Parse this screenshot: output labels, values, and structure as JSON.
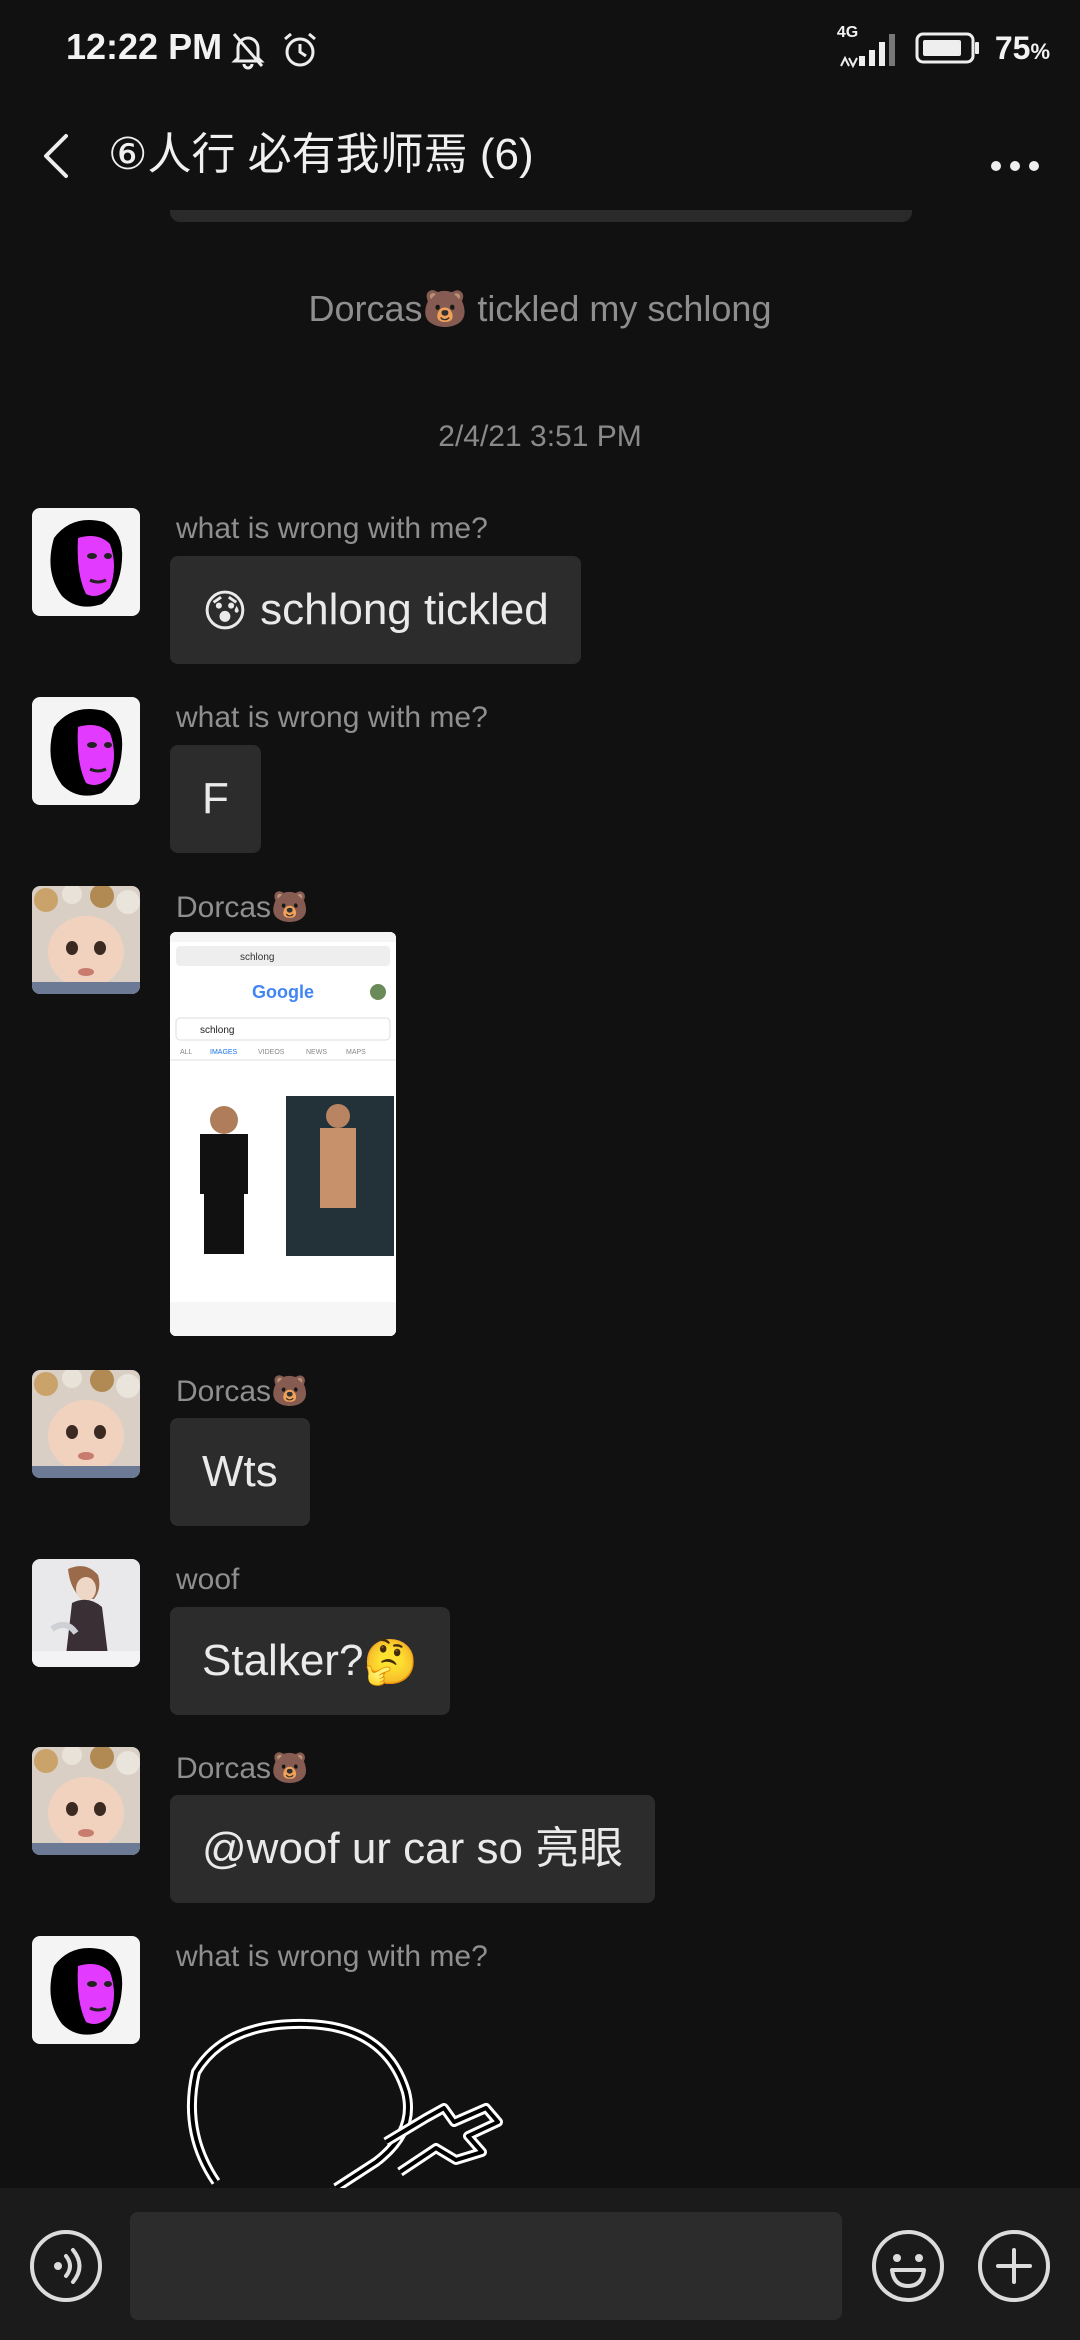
{
  "status": {
    "time": "12:22 PM",
    "network": "4G",
    "battery": "75",
    "battery_unit": "%"
  },
  "header": {
    "title": "⑥人行 必有我师焉 (6)"
  },
  "system_message": "Dorcas🐻 tickled my schlong",
  "timestamp": "2/4/21 3:51 PM",
  "messages": [
    {
      "sender": "what is wrong with me?",
      "text": "schlong tickled",
      "emoji": "😰"
    },
    {
      "sender": "what is wrong with me?",
      "text": "F"
    },
    {
      "sender": "Dorcas🐻",
      "image_text": {
        "search": "schlong",
        "logo": "Google",
        "tabs": [
          "ALL",
          "IMAGES",
          "VIDEOS",
          "NEWS",
          "MAPS"
        ]
      }
    },
    {
      "sender": "Dorcas🐻",
      "text": "Wts"
    },
    {
      "sender": "woof",
      "text": "Stalker?",
      "emoji": "🤔"
    },
    {
      "sender": "Dorcas🐻",
      "text": "@woof ur car so 亮眼"
    },
    {
      "sender": "what is wrong with me?"
    }
  ],
  "input": {
    "placeholder": "",
    "value": ""
  },
  "colors": {
    "background": "#111111",
    "bubble": "#2c2c2c",
    "muted_text": "#8e8e8e",
    "accent_pink": "#e23bff"
  }
}
